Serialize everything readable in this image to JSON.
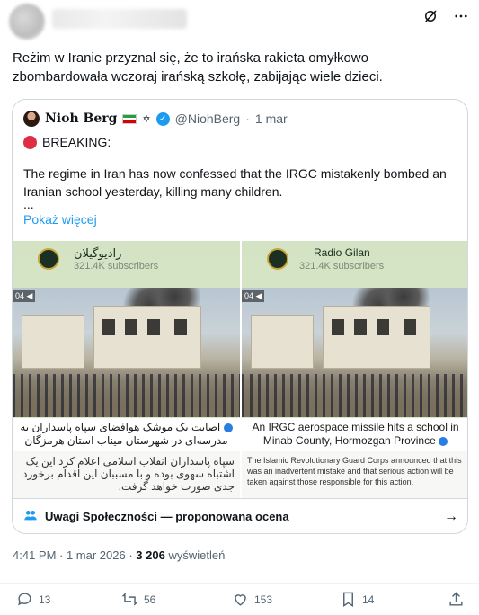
{
  "post": {
    "text": "Reżim w Iranie przyznał się, że to irańska rakieta omyłkowo zbombardowała wczoraj irańską szkołę, zabijając wiele dzieci."
  },
  "quote": {
    "name": "Nioh Berg",
    "handle": "@NiohBerg",
    "dot": "·",
    "date": "1 mar",
    "breaking": "BREAKING:",
    "body": "The regime in Iran has now confessed that the IRGC mistakenly bombed an Iranian school yesterday, killing many children.",
    "ellipsis": "...",
    "show_more": "Pokaż więcej",
    "images": [
      {
        "channel": "راديوگيلان",
        "subscribers": "321.4K subscribers",
        "tag": "04",
        "caption": "اصابت یک موشک هوافضای سپاه پاسداران به مدرسه‌ای در شهرستان میناب استان هرمزگان",
        "description": "سپاه پاسداران انقلاب اسلامی اعلام کرد این یک اشتباه سهوی بوده و با مسببان این اقدام برخورد جدی صورت خواهد گرفت."
      },
      {
        "channel": "Radio Gilan",
        "subscribers": "321.4K subscribers",
        "tag": "04",
        "caption": "An IRGC aerospace missile hits a school in Minab County, Hormozgan Province",
        "description": "The Islamic Revolutionary Guard Corps announced that this was an inadvertent mistake and that serious action will be taken against those responsible for this action."
      }
    ],
    "notes_label": "Uwagi Społeczności — proponowana ocena"
  },
  "meta": {
    "time": "4:41 PM · 1 mar 2026 · ",
    "views_count": "3 206",
    "views_label": " wyświetleń"
  },
  "actions": {
    "replies": "13",
    "reposts": "56",
    "likes": "153",
    "bookmarks": "14"
  },
  "colors": {
    "accent": "#1d9bf0",
    "breaking_dot": "#dd2e44",
    "muted": "#536471"
  },
  "icons": [
    "grok-icon",
    "more-icon",
    "verified-icon",
    "community-notes-icon",
    "arrow-right-icon",
    "reply-icon",
    "repost-icon",
    "like-icon",
    "bookmark-icon",
    "share-icon"
  ]
}
